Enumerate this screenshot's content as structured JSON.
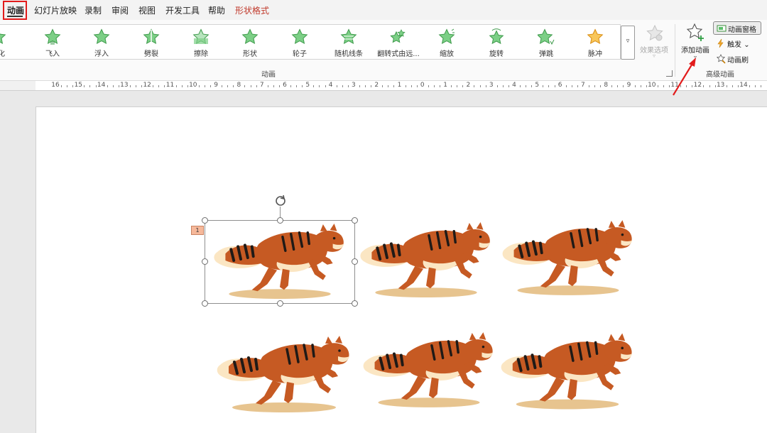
{
  "menu": {
    "items": [
      {
        "label": "动画",
        "state": "active"
      },
      {
        "label": "幻灯片放映"
      },
      {
        "label": "录制"
      },
      {
        "label": "审阅"
      },
      {
        "label": "视图"
      },
      {
        "label": "开发工具"
      },
      {
        "label": "帮助"
      },
      {
        "label": "形状格式",
        "style": "contextual"
      }
    ]
  },
  "ribbon": {
    "gallery": {
      "items": [
        {
          "label": "变化",
          "icon": "star-icon"
        },
        {
          "label": "飞入",
          "icon": "fly-in-star-icon"
        },
        {
          "label": "浮入",
          "icon": "float-in-star-icon"
        },
        {
          "label": "劈裂",
          "icon": "split-star-icon"
        },
        {
          "label": "擦除",
          "icon": "wipe-star-icon"
        },
        {
          "label": "形状",
          "icon": "shape-star-icon"
        },
        {
          "label": "轮子",
          "icon": "wheel-star-icon"
        },
        {
          "label": "随机线条",
          "icon": "random-bars-star-icon"
        },
        {
          "label": "翻转式由远...",
          "icon": "grow-turn-star-icon"
        },
        {
          "label": "缩放",
          "icon": "zoom-star-icon"
        },
        {
          "label": "旋转",
          "icon": "swivel-star-icon"
        },
        {
          "label": "弹跳",
          "icon": "bounce-star-icon"
        },
        {
          "label": "脉冲",
          "icon": "pulse-star-icon"
        }
      ],
      "more_icon": "▿",
      "group_label": "动画"
    },
    "effect_options": {
      "label": "效果选项",
      "chevron": "▿",
      "enabled": false
    },
    "add_animation": {
      "label": "添加动画",
      "chevron": "▿"
    },
    "advanced": {
      "pane_label": "动画窗格",
      "trigger_label": "触发",
      "trigger_chevron": "⌄",
      "painter_label": "动画刷",
      "group_label": "高级动画"
    },
    "colors": {
      "entrance_green": "#5cbf6b",
      "emphasis_gold": "#f2a72a",
      "accent_red": "#e21c1c"
    }
  },
  "ruler": {
    "labels": [
      "16",
      "15",
      "14",
      "13",
      "12",
      "11",
      "10",
      "9",
      "8",
      "7",
      "6",
      "5",
      "4",
      "3",
      "2",
      "1",
      "0",
      "1",
      "2",
      "3",
      "4",
      "5",
      "6",
      "7",
      "8",
      "9",
      "10",
      "11",
      "12",
      "13",
      "14"
    ]
  },
  "slide": {
    "animation_badge": "1",
    "cat_colors": {
      "body": "#c65a23",
      "belly": "#fbe6c3",
      "stripe": "#1f1a17",
      "shadow": "#e7c48f"
    }
  }
}
